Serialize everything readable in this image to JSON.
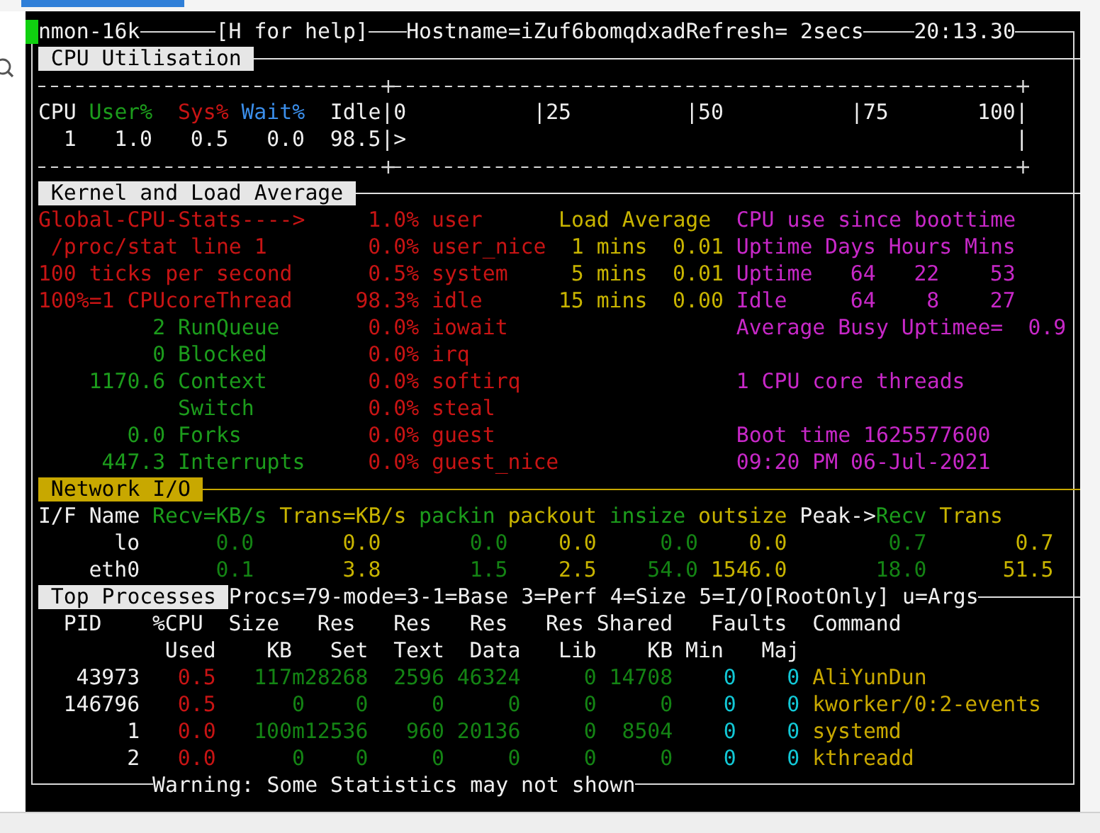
{
  "header": {
    "program": "nmon-16k",
    "help": "[H for help]",
    "host": "Hostname=iZuf6bomqdxadRefresh= 2secs",
    "time": "20:13.30"
  },
  "cpu": {
    "title": "CPU Utilisation",
    "columns": [
      "CPU",
      "User%",
      "Sys%",
      "Wait%",
      "Idle"
    ],
    "scale": [
      "|0",
      "|25",
      "|50",
      "|75",
      "100|"
    ],
    "rows": [
      {
        "cpu": "1",
        "user": "1.0",
        "sys": "0.5",
        "wait": "0.0",
        "idle": "98.5",
        "bar": "|>",
        "end": "|"
      }
    ]
  },
  "kernel": {
    "title": "Kernel and Load Average",
    "cpu_stats": [
      "Global-CPU-Stats---->",
      "/proc/stat line 1",
      "100 ticks per second",
      "100%=1 CPUcoreThread"
    ],
    "counters": [
      {
        "reading": "2",
        "metric": "RunQueue"
      },
      {
        "reading": "0",
        "metric": "Blocked"
      },
      {
        "reading": "1170.6",
        "metric": "Context"
      },
      {
        "metric": "Switch"
      },
      {
        "reading": "0.0",
        "metric": "Forks"
      },
      {
        "reading": "447.3",
        "metric": "Interrupts"
      }
    ],
    "modes": [
      {
        "percent": "1.0%",
        "name": "user"
      },
      {
        "percent": "0.0%",
        "name": "user_nice"
      },
      {
        "percent": "0.5%",
        "name": "system"
      },
      {
        "percent": "98.3%",
        "name": "idle"
      },
      {
        "percent": "0.0%",
        "name": "iowait"
      },
      {
        "percent": "0.0%",
        "name": "irq"
      },
      {
        "percent": "0.0%",
        "name": "softirq"
      },
      {
        "percent": "0.0%",
        "name": "steal"
      },
      {
        "percent": "0.0%",
        "name": "guest"
      },
      {
        "percent": "0.0%",
        "name": "guest_nice"
      }
    ],
    "load_average": {
      "title": "Load Average",
      "rows": [
        {
          "period": "1 mins",
          "value": "0.01"
        },
        {
          "period": "5 mins",
          "value": "0.01"
        },
        {
          "period": "15 mins",
          "value": "0.00"
        }
      ]
    },
    "uptime": {
      "title": "CPU use since boottime",
      "columns": [
        "Uptime",
        "Days",
        "Hours",
        "Mins"
      ],
      "rows": [
        {
          "label": "Uptime",
          "days": "64",
          "hours": "22",
          "mins": "53"
        },
        {
          "label": "Idle",
          "days": "64",
          "hours": "8",
          "mins": "27"
        }
      ],
      "average_busy": {
        "label": "Average Busy Uptimee=",
        "value": "0.9"
      },
      "threads": "1 CPU core threads",
      "boot_time": "Boot time 1625577600",
      "boot_date": "09:20 PM 06-Jul-2021"
    }
  },
  "network": {
    "title": "Network I/O",
    "columns": [
      "I/F Name",
      "Recv=KB/s",
      "Trans=KB/s",
      "packin",
      "packout",
      "insize",
      "outsize",
      "Peak->",
      "Recv",
      "Trans"
    ],
    "rows": [
      {
        "name": "lo",
        "recv": "0.0",
        "trans": "0.0",
        "packin": "0.0",
        "packout": "0.0",
        "insize": "0.0",
        "outsize": "0.0",
        "peak_recv": "0.7",
        "peak_trans": "0.7"
      },
      {
        "name": "eth0",
        "recv": "0.1",
        "trans": "3.8",
        "packin": "1.5",
        "packout": "2.5",
        "insize": "54.0",
        "outsize": "1546.0",
        "peak_recv": "18.0",
        "peak_trans": "51.5"
      }
    ]
  },
  "processes": {
    "title": "Top Processes",
    "info": "Procs=79-mode=3-1=Base 3=Perf 4=Size 5=I/O[RootOnly] u=Args",
    "columns_top": [
      "PID",
      "%CPU",
      "Size",
      "Res",
      "Res",
      "Res",
      "Res",
      "Shared",
      "Faults",
      "Command"
    ],
    "columns_bottom": [
      "Used",
      "KB",
      "Set",
      "Text",
      "Data",
      "Lib",
      "KB",
      "Min",
      "Maj"
    ],
    "rows": [
      {
        "pid": "43973",
        "cpu": "0.5",
        "size": "117m",
        "res_set": "28268",
        "res_text": "2596",
        "res_data": "46324",
        "res_lib": "0",
        "shared_kb": "14708",
        "faults_min": "0",
        "faults_maj": "0",
        "command": "AliYunDun"
      },
      {
        "pid": "146796",
        "cpu": "0.5",
        "size": "0",
        "res_set": "0",
        "res_text": "0",
        "res_data": "0",
        "res_lib": "0",
        "shared_kb": "0",
        "faults_min": "0",
        "faults_maj": "0",
        "command": "kworker/0:2-events"
      },
      {
        "pid": "1",
        "cpu": "0.0",
        "size": "100m",
        "res_set": "12536",
        "res_text": "960",
        "res_data": "20136",
        "res_lib": "0",
        "shared_kb": "8504",
        "faults_min": "0",
        "faults_maj": "0",
        "command": "systemd"
      },
      {
        "pid": "2",
        "cpu": "0.0",
        "size": "0",
        "res_set": "0",
        "res_text": "0",
        "res_data": "0",
        "res_lib": "0",
        "shared_kb": "0",
        "faults_min": "0",
        "faults_maj": "0",
        "command": "kthreadd"
      }
    ],
    "warning": "Warning: Some Statistics may not shown"
  }
}
